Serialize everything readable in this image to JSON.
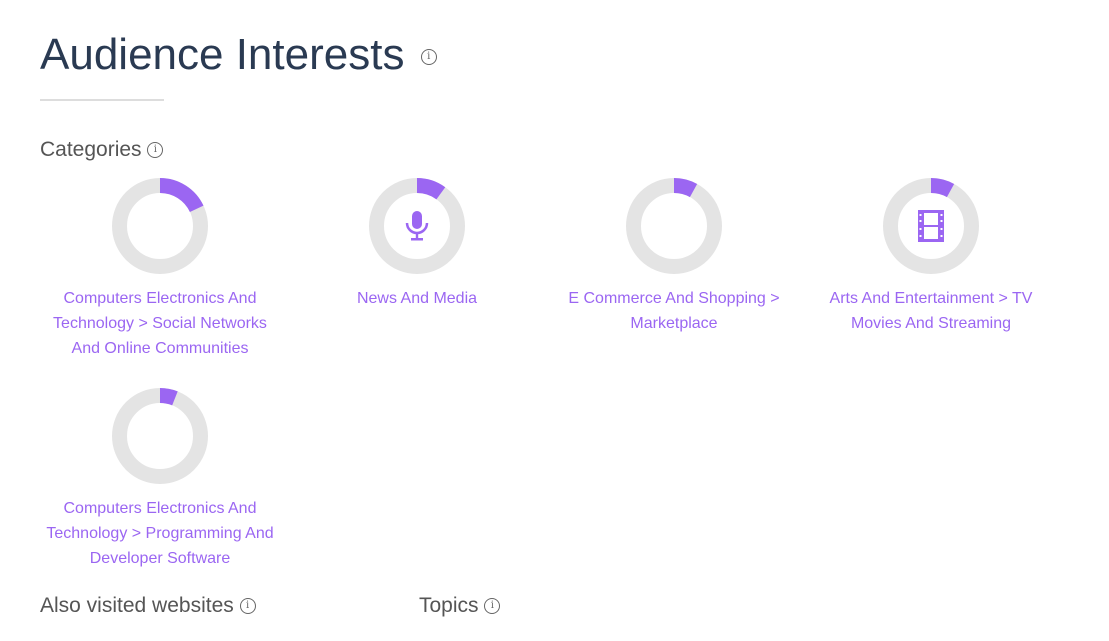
{
  "title": "Audience Interests",
  "sections": {
    "categories": "Categories",
    "also_visited": "Also visited websites",
    "topics": "Topics"
  },
  "colors": {
    "accent": "#9b66f2",
    "ring": "#e4e4e4"
  },
  "categories": [
    {
      "label": "Computers Electronics And Technology > Social Networks And Online Communities",
      "share_pct": 18,
      "icon": ""
    },
    {
      "label": "News And Media",
      "share_pct": 10,
      "icon": "microphone-icon"
    },
    {
      "label": "E Commerce And Shopping > Marketplace",
      "share_pct": 8,
      "icon": ""
    },
    {
      "label": "Arts And Entertainment > TV Movies And Streaming",
      "share_pct": 8,
      "icon": "film-icon"
    },
    {
      "label": "Computers Electronics And Technology > Programming And Developer Software",
      "share_pct": 6,
      "icon": ""
    }
  ]
}
